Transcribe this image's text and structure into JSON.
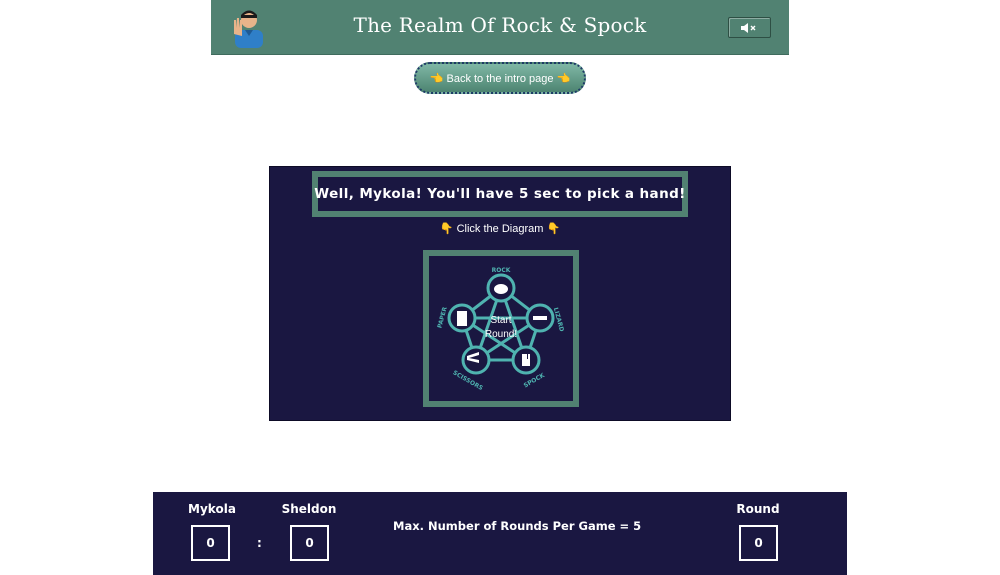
{
  "header": {
    "title": "The Realm Of Rock & Spock",
    "avatar_icon": "spock-avatar-icon",
    "mute_icon": "speaker-muted-icon",
    "background_color": "#518272"
  },
  "nav": {
    "back_label": "👈 Back to the intro page 👈"
  },
  "game": {
    "message": "Well, Mykola! You'll have 5 sec to pick a hand!",
    "hint": "👇 Click the Diagram 👇",
    "panel_color": "#1a1741",
    "accent_color": "#518272",
    "diagram": {
      "center_line1": "Start",
      "center_line2": "Round!",
      "hands": {
        "rock": "ROCK",
        "lizard": "LIZARD",
        "spock": "SPOCK",
        "scissors": "SCISSORS",
        "paper": "PAPER"
      }
    }
  },
  "scoreboard": {
    "player_name": "Mykola",
    "player_score": "0",
    "separator": ":",
    "opponent_name": "Sheldon",
    "opponent_score": "0",
    "max_rounds_text": "Max. Number of Rounds Per Game = 5",
    "round_label": "Round",
    "round_value": "0"
  }
}
